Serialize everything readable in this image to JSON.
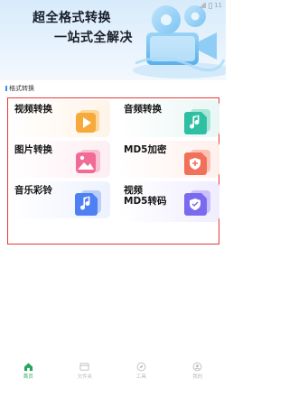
{
  "status_bar": {
    "time": "11"
  },
  "banner": {
    "line1": "超全格式转换",
    "line2": "一站式全解决"
  },
  "section_label": "格式转换",
  "cards": [
    {
      "label": "视频转换",
      "icon": "play-icon",
      "color": "#f7a93b"
    },
    {
      "label": "音频转换",
      "icon": "music-note-icon",
      "color": "#2fbfa3"
    },
    {
      "label": "图片转换",
      "icon": "image-icon",
      "color": "#f06b95"
    },
    {
      "label": "MD5加密",
      "icon": "shield-plus-icon",
      "color": "#f2705a"
    },
    {
      "label": "音乐彩铃",
      "icon": "music-note-icon",
      "color": "#4e7ff3"
    },
    {
      "label": "视频\nMD5转码",
      "icon": "shield-check-icon",
      "color": "#7a6af0"
    }
  ],
  "bottom_nav": [
    {
      "label": "首页",
      "icon": "home-icon",
      "active": true
    },
    {
      "label": "文件夹",
      "icon": "folder-icon",
      "active": false
    },
    {
      "label": "工具",
      "icon": "compass-icon",
      "active": false
    },
    {
      "label": "我的",
      "icon": "user-icon",
      "active": false
    }
  ]
}
